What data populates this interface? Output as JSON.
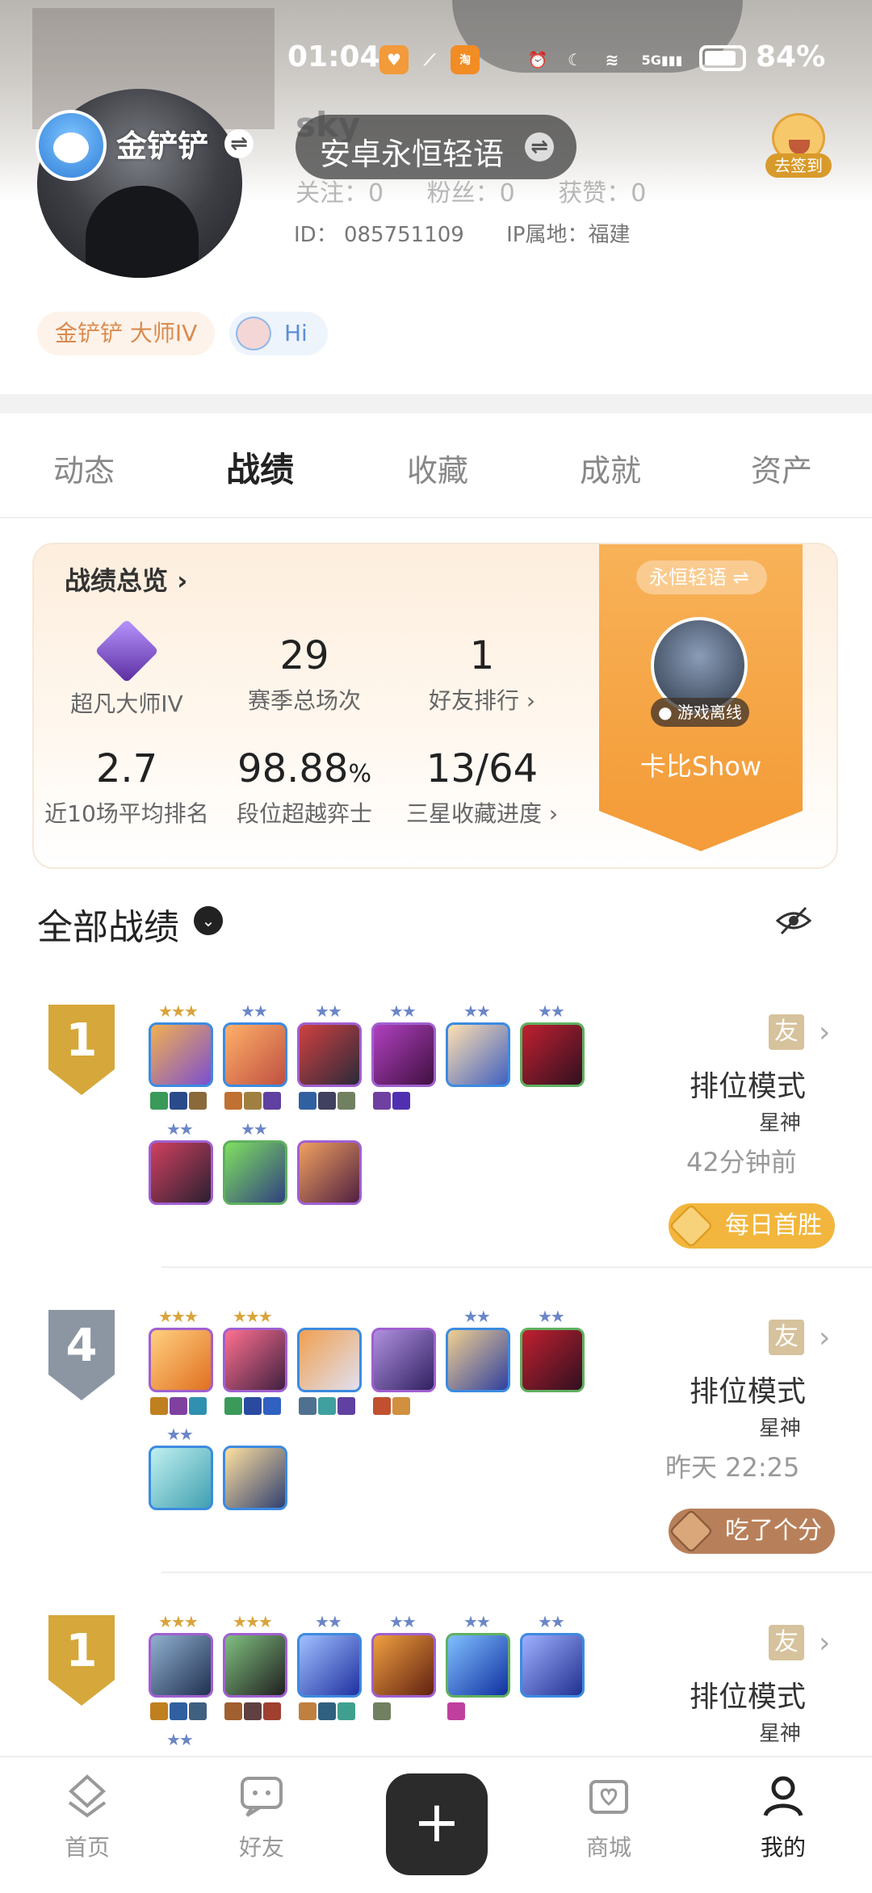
{
  "status_bar": {
    "time": "01:04",
    "network": "5G",
    "battery": "84%"
  },
  "profile": {
    "nickname": "金铲铲",
    "account_name": "安卓永恒轻语",
    "ghost_name": "sky",
    "follow": "关注：0",
    "fans": "粉丝：0",
    "likes": "获赞：0",
    "id": "ID：  085751109",
    "ip": "IP属地：福建",
    "checkin_label": "去签到",
    "tag_rank": "金铲铲 大师IV",
    "tag_hi": "Hi"
  },
  "tabs": [
    "动态",
    "战绩",
    "收藏",
    "成就",
    "资产"
  ],
  "active_tab": "战绩",
  "overview": {
    "title": "战绩总览",
    "stats": [
      {
        "value": "",
        "label": "超凡大师IV"
      },
      {
        "value": "29",
        "label": "赛季总场次"
      },
      {
        "value": "1",
        "label": "好友排行 ›"
      },
      {
        "value": "2.7",
        "label": "近10场平均排名"
      },
      {
        "value": "98.88",
        "unit": "%",
        "label": "段位超越弈士"
      },
      {
        "value": "13/64",
        "label": "三星收藏进度 ›"
      }
    ],
    "ribbon": {
      "name": "永恒轻语",
      "status": "游戏离线",
      "show": "卡比Show"
    }
  },
  "section": {
    "title": "全部战绩"
  },
  "matches": [
    {
      "rank": "1",
      "badge": "gold",
      "tag": "友",
      "mode": "排位模式",
      "map": "星神",
      "time": "42分钟前",
      "pill": "每日首胜",
      "pill_color": "#f0b43a"
    },
    {
      "rank": "4",
      "badge": "gray",
      "tag": "友",
      "mode": "排位模式",
      "map": "星神",
      "time": "昨天 22:25",
      "pill": "吃了个分",
      "pill_color": "#b07a4a"
    },
    {
      "rank": "1",
      "badge": "gold",
      "tag": "友",
      "mode": "排位模式",
      "map": "星神",
      "time": "",
      "pill": "",
      "pill_color": ""
    }
  ],
  "bottom_nav": [
    {
      "label": "首页",
      "icon": "home-icon"
    },
    {
      "label": "好友",
      "icon": "chat-icon"
    },
    {
      "label": "商城",
      "icon": "shop-icon"
    },
    {
      "label": "我的",
      "icon": "profile-icon"
    }
  ]
}
